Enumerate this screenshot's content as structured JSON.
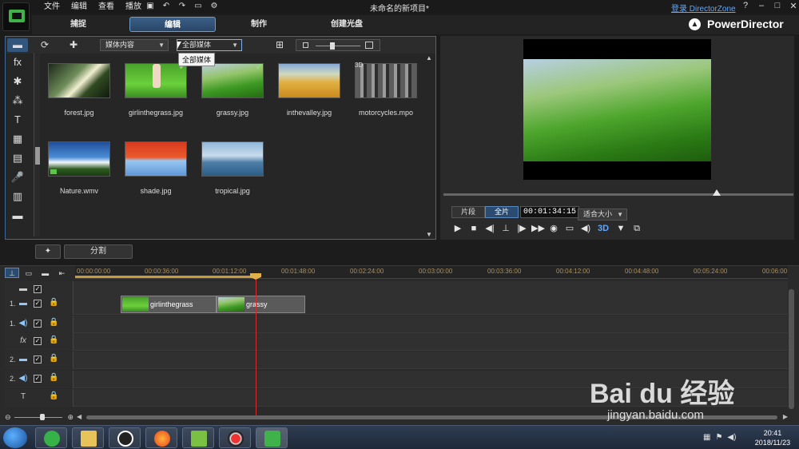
{
  "menu": [
    "文件",
    "编辑",
    "查看",
    "播放"
  ],
  "window_title": "未命名的新项目*",
  "login_link": "登录 DirectorZone",
  "window_controls": [
    "?",
    "–",
    "□",
    "✕"
  ],
  "brand": "PowerDirector",
  "mode_tabs": [
    "捕捉",
    "编辑",
    "制作",
    "创建光盘"
  ],
  "active_mode": "编辑",
  "library": {
    "content_dropdown": "媒体内容",
    "filter_dropdown": "全部媒体",
    "tooltip": "全部媒体",
    "items": [
      {
        "name": "forest.jpg",
        "checked": false
      },
      {
        "name": "girlinthegrass.jpg",
        "checked": true
      },
      {
        "name": "grassy.jpg",
        "checked": true
      },
      {
        "name": "inthevalley.jpg",
        "checked": false
      },
      {
        "name": "motorcycles.mpo",
        "badge": "3D",
        "checked": false
      },
      {
        "name": "Nature.wmv",
        "checked": false
      },
      {
        "name": "shade.jpg",
        "checked": false
      },
      {
        "name": "tropical.jpg",
        "checked": false
      }
    ]
  },
  "preview": {
    "clip_label": "片段",
    "full_label": "全片",
    "timecode": "00:01:34:15",
    "fit_dropdown": "适合大小",
    "three_d": "3D"
  },
  "midbar": {
    "split_label": "分割"
  },
  "timeline": {
    "ruler_ticks": [
      "00:00:00:00",
      "00:00:36:00",
      "00:01:12:00",
      "00:01:48:00",
      "00:02:24:00",
      "00:03:00:00",
      "00:03:36:00",
      "00:04:12:00",
      "00:04:48:00",
      "00:05:24:00",
      "00:06:00"
    ],
    "tracks": [
      {
        "num": "",
        "icon": "▬"
      },
      {
        "num": "1.",
        "icon": "▬"
      },
      {
        "num": "1.",
        "icon": "◀)"
      },
      {
        "num": "",
        "icon": "fx"
      },
      {
        "num": "2.",
        "icon": "▬"
      },
      {
        "num": "2.",
        "icon": "◀)"
      },
      {
        "num": "",
        "icon": "T"
      }
    ],
    "clips": [
      {
        "name": "girlinthegrass"
      },
      {
        "name": "grassy"
      }
    ]
  },
  "taskbar": {
    "clock_time": "20:41",
    "clock_date": "2018/11/23"
  },
  "watermark": {
    "logo": "Bai du 经验",
    "url": "jingyan.baidu.com"
  }
}
